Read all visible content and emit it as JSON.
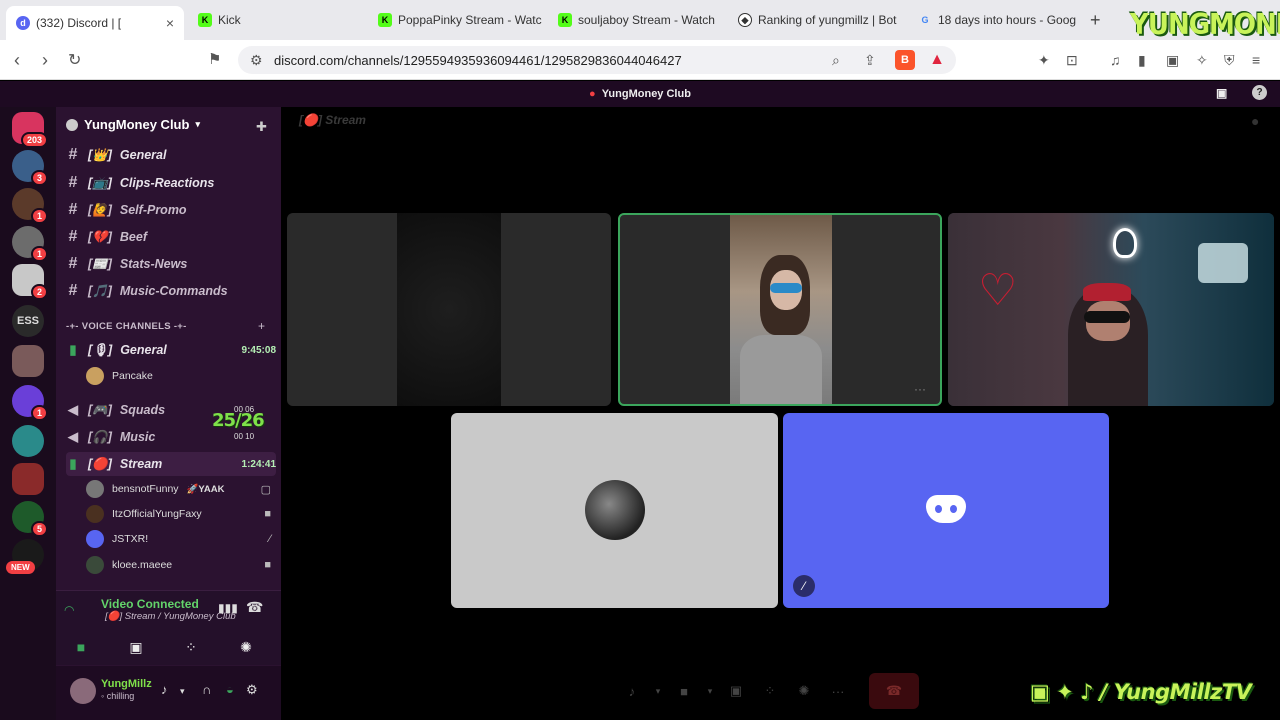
{
  "tabs": [
    {
      "title": "(332) Discord | [",
      "favicon": "discord",
      "active": true
    },
    {
      "title": "Kick",
      "favicon": "kick"
    },
    {
      "title": "PoppaPinky Stream - Watc",
      "favicon": "kick"
    },
    {
      "title": "souljaboy Stream - Watch",
      "favicon": "kick"
    },
    {
      "title": "Ranking of yungmillz | Bot",
      "favicon": "bot"
    },
    {
      "title": "18 days into hours - Goog",
      "favicon": "google"
    }
  ],
  "brand_logo": "YUNGMONEY",
  "url": "discord.com/channels/1295594935936094461/1295829836044046427",
  "window_title": "YungMoney Club",
  "guild_badges": [
    "203",
    "3",
    "1",
    "1",
    "2",
    "",
    "1",
    "",
    "",
    "5",
    "NEW"
  ],
  "guild_ess": "ESS",
  "server_name": "YungMoney Club",
  "text_channels": [
    {
      "name": "General",
      "prefix": "[👑]"
    },
    {
      "name": "Clips-Reactions",
      "prefix": "[📺]"
    },
    {
      "name": "Self-Promo",
      "prefix": "[🙋]"
    },
    {
      "name": "Beef",
      "prefix": "[💔]"
    },
    {
      "name": "Stats-News",
      "prefix": "[📰]"
    },
    {
      "name": "Music-Commands",
      "prefix": "[🎵]"
    }
  ],
  "voice_category": "-+- VOICE CHANNELS -+-",
  "voice_channels": [
    {
      "name": "General",
      "prefix": "[🎙]",
      "time": "9:45:08"
    },
    {
      "name": "Squads",
      "prefix": "[🎮]",
      "counts": "00  06"
    },
    {
      "name": "Music",
      "prefix": "[🎧]",
      "counts": "00  10"
    },
    {
      "name": "Stream",
      "prefix": "[🔴]",
      "time": "1:24:41"
    }
  ],
  "general_member": "Pancake",
  "overlay_count": "25/26",
  "stream_members": [
    {
      "name": "bensnotFunny",
      "tag": "🚀YAAK"
    },
    {
      "name": "ItzOfficialYungFaxy",
      "tag": ""
    },
    {
      "name": "JSTXR!",
      "tag": ""
    },
    {
      "name": "kloee.maeee",
      "tag": ""
    }
  ],
  "voice_status": {
    "title": "Video Connected",
    "subtitle": "[🔴] Stream / YungMoney Club"
  },
  "user": {
    "name": "YungMillz",
    "status": "chilling"
  },
  "main_header": "[🔴] Stream",
  "social_handle": "/ YungMillzTV",
  "colors": {
    "discord_blurple": "#5865f2",
    "speaking_green": "#3ba55c",
    "sidebar": "#2b1230",
    "brand_green": "#c8f35a"
  }
}
